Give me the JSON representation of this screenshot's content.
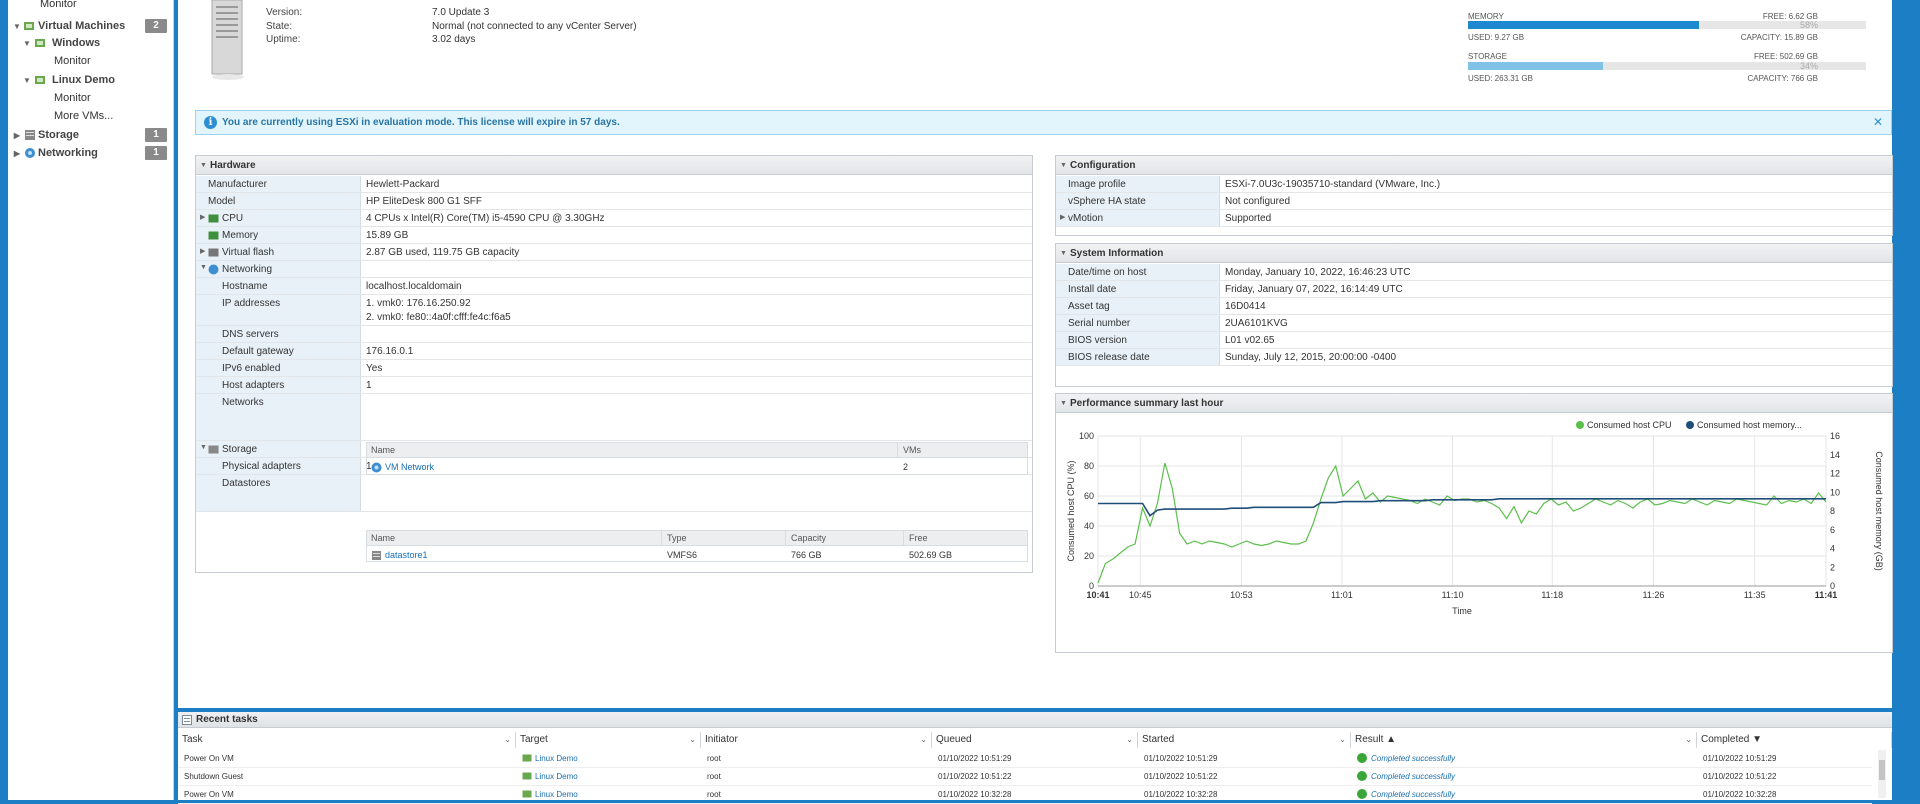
{
  "sidebar": {
    "items": [
      {
        "label": "Monitor"
      },
      {
        "label": "Virtual Machines",
        "badge": "2"
      },
      {
        "label": "Windows"
      },
      {
        "label": "Monitor"
      },
      {
        "label": "Linux Demo"
      },
      {
        "label": "Monitor"
      },
      {
        "label": "More VMs..."
      },
      {
        "label": "Storage",
        "badge": "1"
      },
      {
        "label": "Networking",
        "badge": "1"
      }
    ]
  },
  "host": {
    "version_label": "Version:",
    "version": "7.0 Update 3",
    "state_label": "State:",
    "state": "Normal (not connected to any vCenter Server)",
    "uptime_label": "Uptime:",
    "uptime": "3.02 days"
  },
  "resources": {
    "memory": {
      "label": "MEMORY",
      "free": "FREE: 6.62 GB",
      "pct": "58%",
      "pct_value": 58,
      "used": "USED: 9.27 GB",
      "capacity": "CAPACITY: 15.89 GB",
      "color": "#1e88d0"
    },
    "storage": {
      "label": "STORAGE",
      "free": "FREE: 502.69 GB",
      "pct": "34%",
      "pct_value": 34,
      "used": "USED: 263.31 GB",
      "capacity": "CAPACITY: 766 GB",
      "color": "#80c3e6"
    }
  },
  "banner": {
    "text": "You are currently using ESXi in evaluation mode. This license will expire in 57 days."
  },
  "hardware": {
    "title": "Hardware",
    "rows": [
      {
        "label": "Manufacturer",
        "value": "Hewlett-Packard"
      },
      {
        "label": "Model",
        "value": "HP EliteDesk 800 G1 SFF"
      },
      {
        "label": "CPU",
        "value": "4 CPUs x Intel(R) Core(TM) i5-4590 CPU @ 3.30GHz"
      },
      {
        "label": "Memory",
        "value": "15.89 GB"
      },
      {
        "label": "Virtual flash",
        "value": "2.87 GB used, 119.75 GB capacity"
      },
      {
        "label": "Networking",
        "value": ""
      },
      {
        "label": "Hostname",
        "value": "localhost.localdomain"
      },
      {
        "label": "IP addresses",
        "value": "1. vmk0: 176.16.250.92",
        "value2": "2. vmk0: fe80::4a0f:cfff:fe4c:f6a5"
      },
      {
        "label": "DNS servers",
        "value": ""
      },
      {
        "label": "Default gateway",
        "value": "176.16.0.1"
      },
      {
        "label": "IPv6 enabled",
        "value": "Yes"
      },
      {
        "label": "Host adapters",
        "value": "1"
      },
      {
        "label": "Networks",
        "value": ""
      },
      {
        "label": "Storage",
        "value": ""
      },
      {
        "label": "Physical adapters",
        "value": "1"
      },
      {
        "label": "Datastores",
        "value": ""
      }
    ],
    "networks_table": {
      "headers": [
        "Name",
        "VMs"
      ],
      "rows": [
        {
          "name": "VM Network",
          "vms": "2"
        }
      ]
    },
    "datastores_table": {
      "headers": [
        "Name",
        "Type",
        "Capacity",
        "Free"
      ],
      "rows": [
        {
          "name": "datastore1",
          "type": "VMFS6",
          "capacity": "766 GB",
          "free": "502.69 GB"
        }
      ]
    }
  },
  "configuration": {
    "title": "Configuration",
    "rows": [
      {
        "label": "Image profile",
        "value": "ESXi-7.0U3c-19035710-standard (VMware, Inc.)"
      },
      {
        "label": "vSphere HA state",
        "value": "Not configured"
      },
      {
        "label": "vMotion",
        "value": "Supported"
      }
    ]
  },
  "system": {
    "title": "System Information",
    "rows": [
      {
        "label": "Date/time on host",
        "value": "Monday, January 10, 2022, 16:46:23 UTC"
      },
      {
        "label": "Install date",
        "value": "Friday, January 07, 2022, 16:14:49 UTC"
      },
      {
        "label": "Asset tag",
        "value": "16D0414"
      },
      {
        "label": "Serial number",
        "value": "2UA6101KVG"
      },
      {
        "label": "BIOS version",
        "value": "L01 v02.65"
      },
      {
        "label": "BIOS release date",
        "value": "Sunday, July 12, 2015, 20:00:00 -0400"
      }
    ]
  },
  "performance": {
    "title": "Performance summary last hour",
    "chart_data": {
      "type": "line",
      "xlabel": "Time",
      "ylabel": "Consumed host CPU (%)",
      "y2label": "Consumed host memory (GB)",
      "x_ticks": [
        "10:41",
        "10:45",
        "10:53",
        "11:01",
        "11:10",
        "11:18",
        "11:26",
        "11:35",
        "11:41"
      ],
      "y_ticks": [
        0,
        20,
        40,
        60,
        80,
        100
      ],
      "y2_ticks": [
        0,
        2,
        4,
        6,
        8,
        10,
        12,
        14,
        16
      ],
      "ylim": [
        0,
        100
      ],
      "y2lim": [
        0,
        16
      ],
      "grid": true,
      "legend_position": "top-right",
      "series": [
        {
          "name": "Consumed host CPU",
          "color": "#5bbf4b",
          "axis": "left",
          "values": [
            2,
            15,
            18,
            22,
            26,
            28,
            52,
            40,
            55,
            82,
            65,
            35,
            28,
            30,
            28,
            30,
            29,
            28,
            26,
            28,
            30,
            28,
            27,
            28,
            30,
            29,
            28,
            28,
            30,
            42,
            58,
            72,
            80,
            60,
            65,
            70,
            58,
            62,
            56,
            60,
            59,
            58,
            57,
            55,
            58,
            56,
            54,
            60,
            57,
            58,
            58,
            56,
            57,
            55,
            52,
            45,
            53,
            42,
            50,
            48,
            55,
            58,
            54,
            56,
            50,
            52,
            55,
            58,
            56,
            54,
            57,
            55,
            52,
            56,
            58,
            54,
            55,
            57,
            56,
            55,
            58,
            56,
            54,
            57,
            56,
            55,
            58,
            57,
            56,
            55,
            54,
            60,
            55,
            57,
            56,
            58,
            55,
            62,
            56
          ]
        },
        {
          "name": "Consumed host memory...",
          "color": "#1f4e79",
          "axis": "right",
          "values": [
            8.8,
            8.8,
            8.8,
            8.8,
            8.8,
            8.8,
            8.8,
            7.5,
            8.1,
            8.2,
            8.2,
            8.2,
            8.2,
            8.2,
            8.2,
            8.2,
            8.2,
            8.2,
            8.3,
            8.3,
            8.3,
            8.4,
            8.4,
            8.4,
            8.4,
            8.4,
            8.4,
            8.4,
            8.4,
            8.4,
            8.9,
            8.9,
            8.9,
            9.0,
            9.0,
            9.0,
            9.0,
            9.0,
            9.1,
            9.1,
            9.1,
            9.1,
            9.1,
            9.1,
            9.1,
            9.2,
            9.2,
            9.2,
            9.2,
            9.2,
            9.2,
            9.2,
            9.2,
            9.2,
            9.3,
            9.3,
            9.3,
            9.3,
            9.3,
            9.3,
            9.3,
            9.3,
            9.3,
            9.3,
            9.3,
            9.3,
            9.3,
            9.3,
            9.3,
            9.3,
            9.3,
            9.3,
            9.3,
            9.3,
            9.3,
            9.3,
            9.3,
            9.3,
            9.3,
            9.3,
            9.3,
            9.3,
            9.3,
            9.3,
            9.3,
            9.3,
            9.3,
            9.3,
            9.3,
            9.3,
            9.3,
            9.3,
            9.3,
            9.3,
            9.3,
            9.3,
            9.3,
            9.3,
            9.3
          ]
        }
      ]
    }
  },
  "tasks": {
    "title": "Recent tasks",
    "headers": [
      "Task",
      "Target",
      "Initiator",
      "Queued",
      "Started",
      "Result ▲",
      "Completed ▼"
    ],
    "rows": [
      {
        "task": "Power On VM",
        "target": "Linux Demo",
        "initiator": "root",
        "queued": "01/10/2022 10:51:29",
        "started": "01/10/2022 10:51:29",
        "result": "Completed successfully",
        "completed": "01/10/2022 10:51:29"
      },
      {
        "task": "Shutdown Guest",
        "target": "Linux Demo",
        "initiator": "root",
        "queued": "01/10/2022 10:51:22",
        "started": "01/10/2022 10:51:22",
        "result": "Completed successfully",
        "completed": "01/10/2022 10:51:22"
      },
      {
        "task": "Power On VM",
        "target": "Linux Demo",
        "initiator": "root",
        "queued": "01/10/2022 10:32:28",
        "started": "01/10/2022 10:32:28",
        "result": "Completed successfully",
        "completed": "01/10/2022 10:32:28"
      }
    ]
  }
}
